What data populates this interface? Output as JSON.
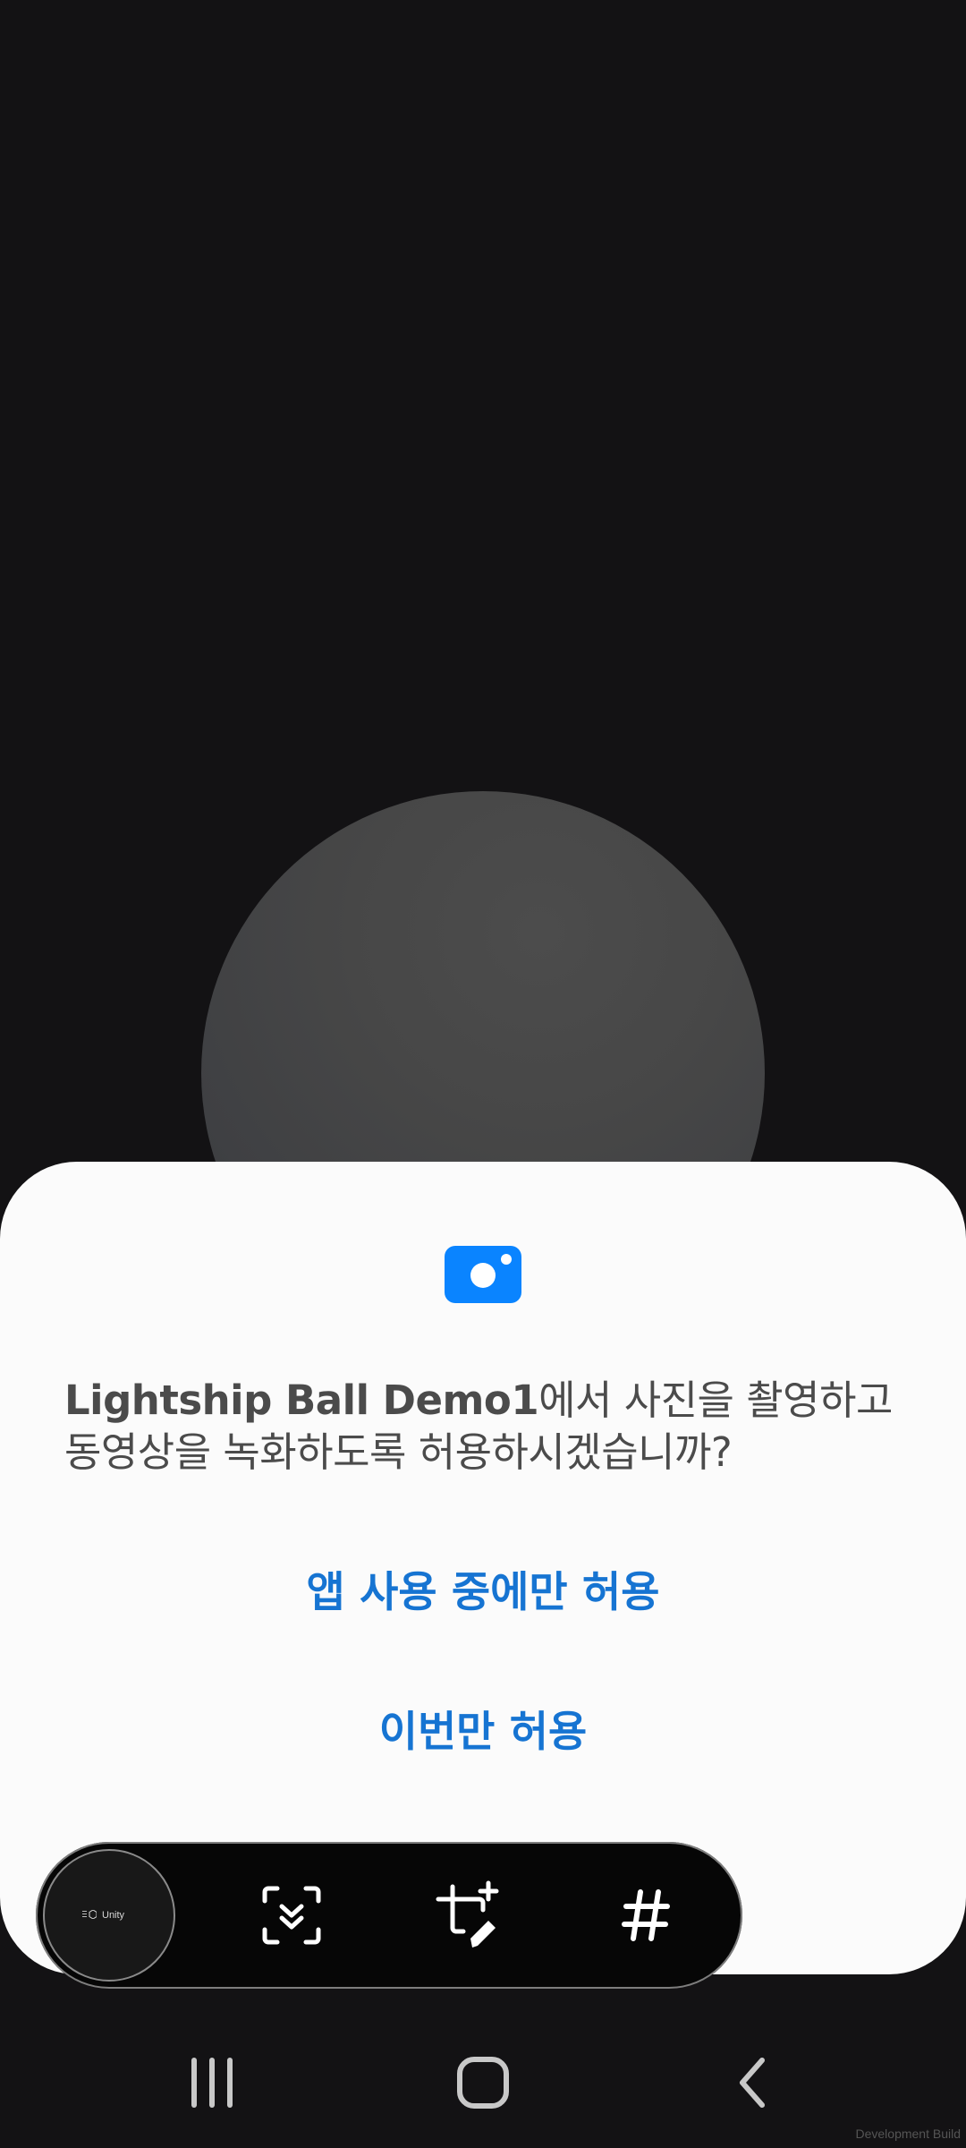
{
  "permission_dialog": {
    "icon": "camera-icon",
    "app_name": "Lightship Ball Demo1",
    "prompt_line1_rest": "에서 사진을 촬영하고",
    "prompt_line2": "동영상을 녹화하도록 허용하시겠습니까?",
    "allow_while_using_label": "앱 사용 중에만 허용",
    "allow_once_label": "이번만 허용",
    "accent_color": "#1674d2"
  },
  "capture_toolbar": {
    "thumbnail_label": "Unity",
    "buttons": [
      {
        "icon": "scroll-capture-icon"
      },
      {
        "icon": "crop-draw-icon"
      },
      {
        "icon": "hashtag-icon"
      }
    ]
  },
  "navigation_bar": {
    "buttons": [
      {
        "icon": "recent-apps-icon"
      },
      {
        "icon": "home-icon"
      },
      {
        "icon": "back-icon"
      }
    ]
  },
  "watermark": "Development Build"
}
